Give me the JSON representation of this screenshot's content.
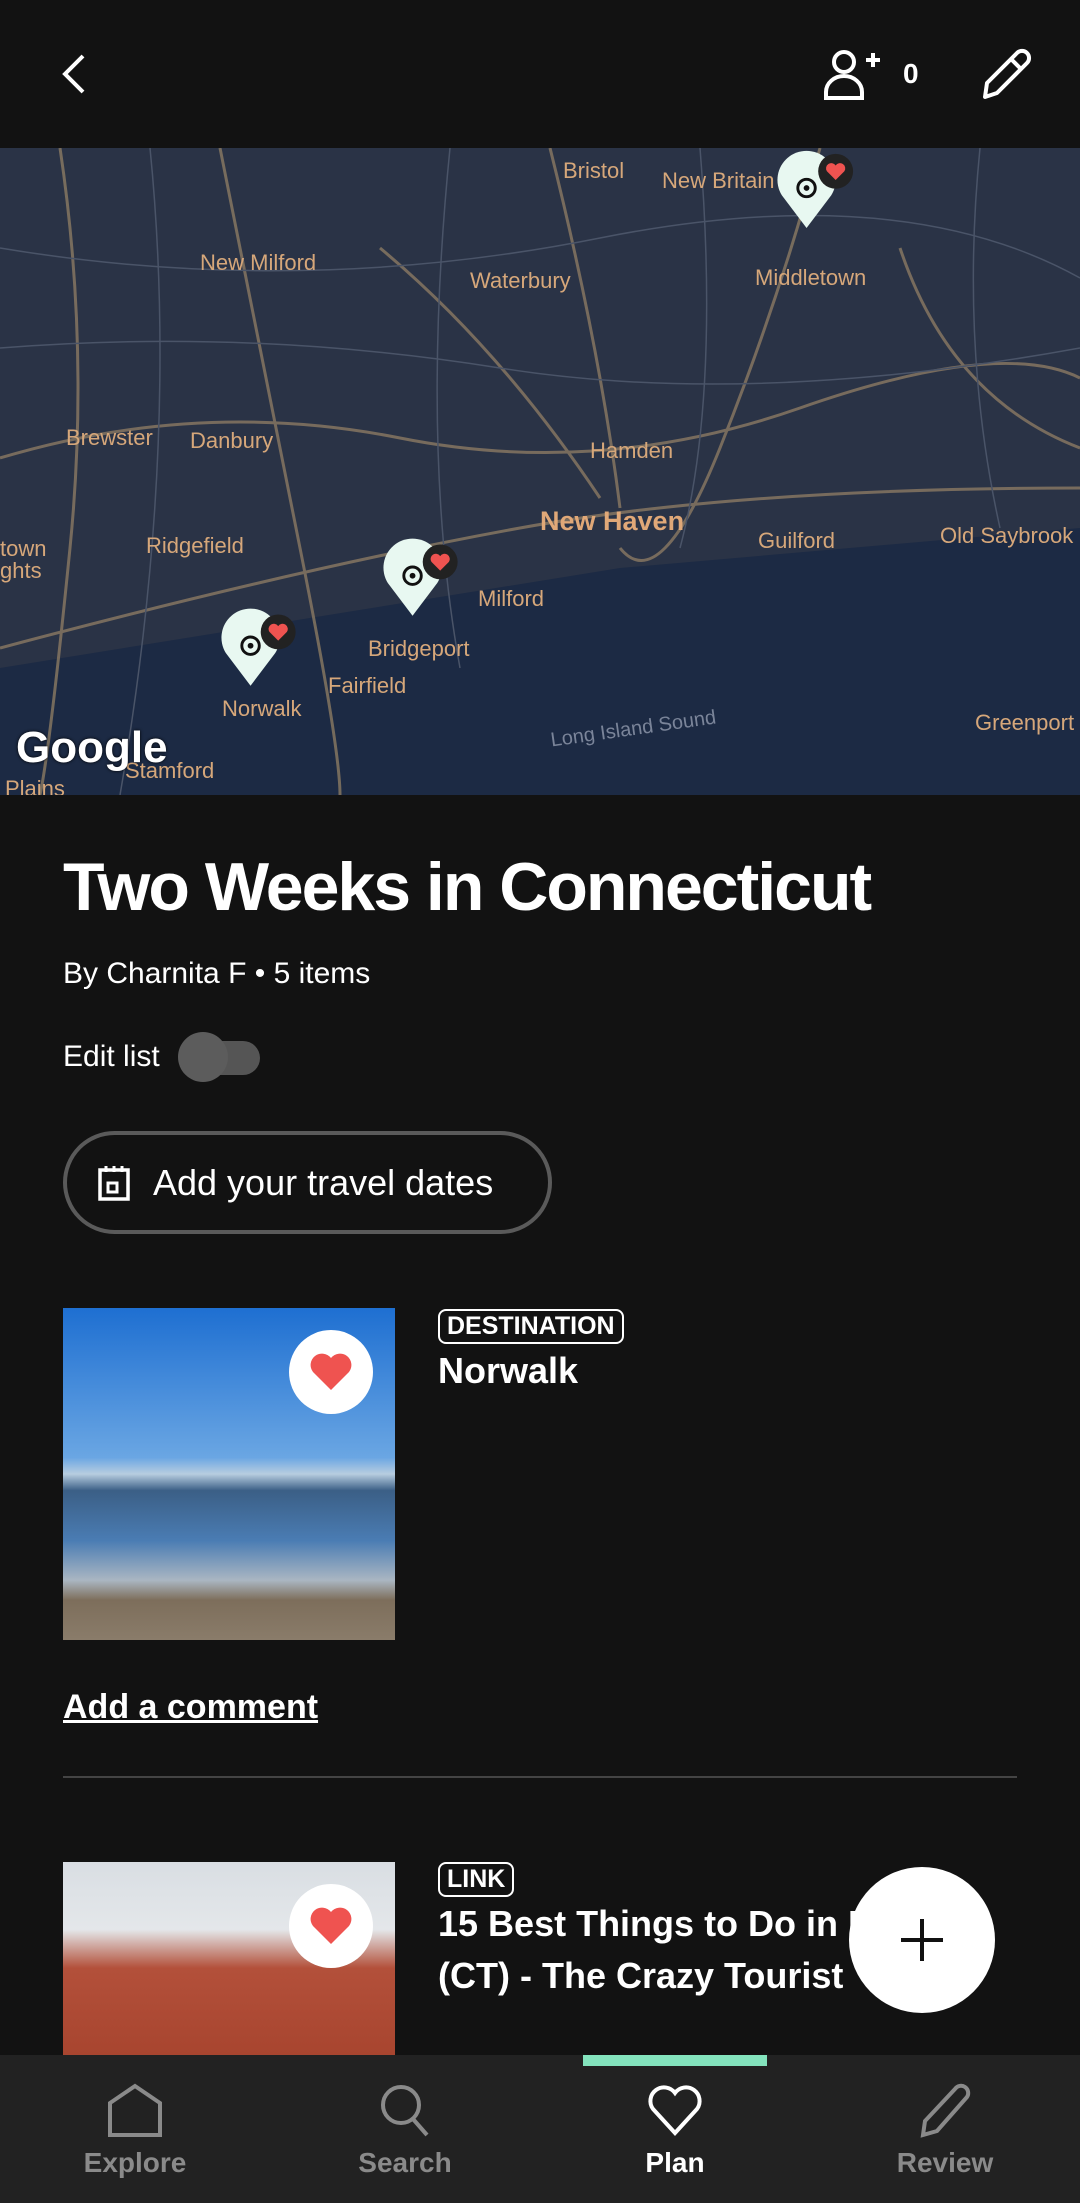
{
  "header": {
    "collaborator_count": "0"
  },
  "map": {
    "labels": {
      "bristol": "Bristol",
      "new_britain": "New Britain",
      "new_milford": "New Milford",
      "waterbury": "Waterbury",
      "middletown": "Middletown",
      "brewster": "Brewster",
      "danbury": "Danbury",
      "hamden": "Hamden",
      "new_haven": "New Haven",
      "guilford": "Guilford",
      "old_saybrook": "Old Saybrook",
      "ridgefield": "Ridgefield",
      "milford": "Milford",
      "bridgeport": "Bridgeport",
      "fairfield": "Fairfield",
      "norwalk": "Norwalk",
      "stamford": "Stamford",
      "greenport": "Greenport",
      "long_island_sound": "Long Island Sound",
      "plains": "Plains",
      "town": "town",
      "hts": "ghts"
    },
    "attribution": "Google",
    "accent": "#ef5350"
  },
  "list": {
    "title": "Two Weeks in Connecticut",
    "byline": "By Charnita F • 5 items",
    "edit_label": "Edit list",
    "edit_enabled": false,
    "dates_button": "Add your travel dates"
  },
  "items": [
    {
      "tag": "DESTINATION",
      "title": "Norwalk",
      "saved": true,
      "comment_link": "Add a comment"
    },
    {
      "tag": "LINK",
      "title": "15 Best Things to Do in Norwalk (CT) - The Crazy Tourist",
      "saved": true
    }
  ],
  "nav": {
    "items": [
      {
        "label": "Explore"
      },
      {
        "label": "Search"
      },
      {
        "label": "Plan"
      },
      {
        "label": "Review"
      }
    ],
    "active": "Plan",
    "indicator_color": "#84e3bd"
  }
}
